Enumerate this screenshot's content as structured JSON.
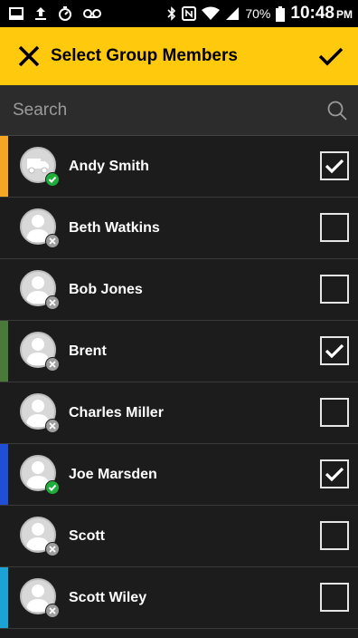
{
  "status_bar": {
    "battery_pct": "70%",
    "time": "10:48",
    "ampm": "PM"
  },
  "app_bar": {
    "title": "Select Group Members",
    "close_icon": "close-icon",
    "confirm_icon": "checkmark-icon"
  },
  "search": {
    "placeholder": "Search",
    "value": ""
  },
  "members": [
    {
      "name": "Andy Smith",
      "checked": true,
      "stripe": "#f5a623",
      "status": "online",
      "avatar": "truck"
    },
    {
      "name": "Beth Watkins",
      "checked": false,
      "stripe": "",
      "status": "offline",
      "avatar": "person"
    },
    {
      "name": "Bob Jones",
      "checked": false,
      "stripe": "",
      "status": "offline",
      "avatar": "person"
    },
    {
      "name": "Brent",
      "checked": true,
      "stripe": "#4a7a3a",
      "status": "offline",
      "avatar": "person"
    },
    {
      "name": "Charles Miller",
      "checked": false,
      "stripe": "",
      "status": "offline",
      "avatar": "person"
    },
    {
      "name": "Joe Marsden",
      "checked": true,
      "stripe": "#1f4fd6",
      "status": "online",
      "avatar": "person"
    },
    {
      "name": "Scott",
      "checked": false,
      "stripe": "",
      "status": "offline",
      "avatar": "person"
    },
    {
      "name": "Scott Wiley",
      "checked": false,
      "stripe": "#1ba3d6",
      "status": "offline",
      "avatar": "person"
    }
  ],
  "colors": {
    "accent": "#ffc90e",
    "background": "#1c1c1c",
    "online": "#1fae3b",
    "offline": "#9e9e9e"
  }
}
